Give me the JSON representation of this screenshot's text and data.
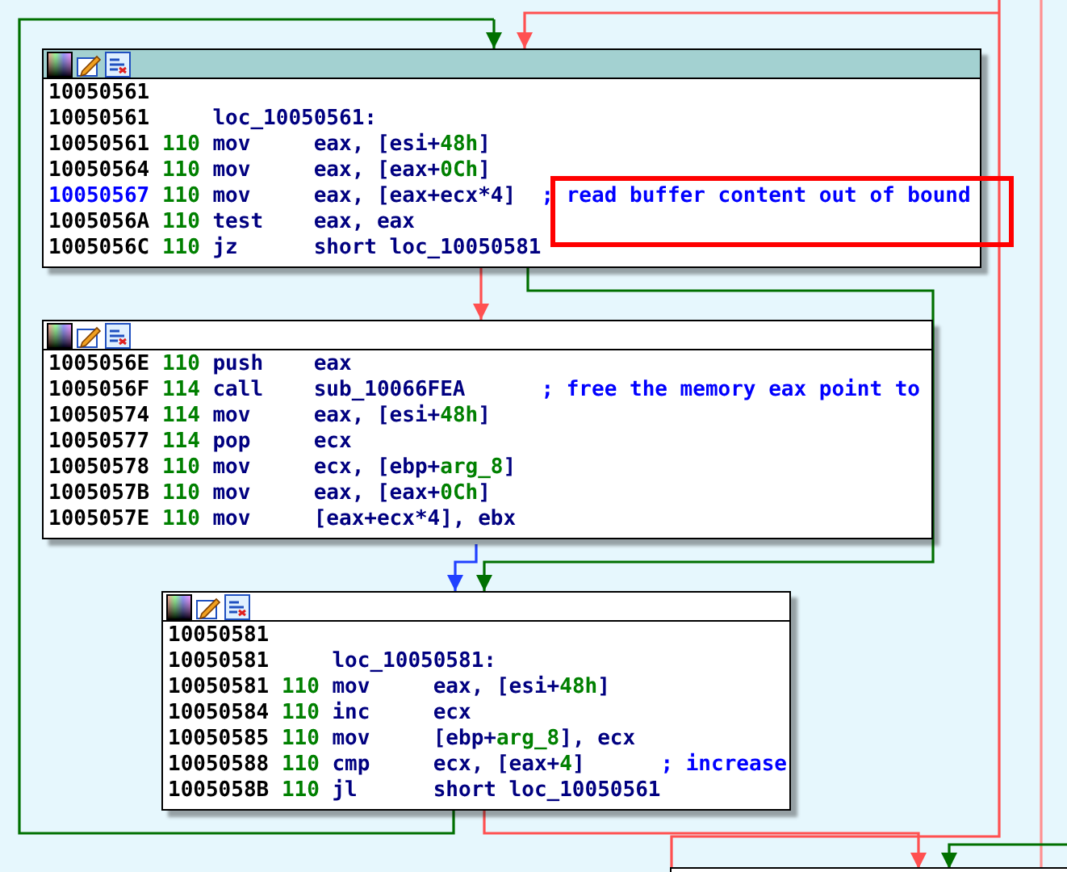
{
  "blocks": [
    {
      "selected": true,
      "lines": [
        {
          "current": false,
          "address": "10050561"
        },
        {
          "current": false,
          "address": "10050561",
          "label": "loc_10050561:"
        },
        {
          "current": false,
          "address": "10050561",
          "stack": "110",
          "mnemonic": "mov",
          "operands": [
            {
              "kind": "reg",
              "text": "eax, [esi+"
            },
            {
              "kind": "num",
              "text": "48h"
            },
            {
              "kind": "reg",
              "text": "]"
            }
          ]
        },
        {
          "current": false,
          "address": "10050564",
          "stack": "110",
          "mnemonic": "mov",
          "operands": [
            {
              "kind": "reg",
              "text": "eax, [eax+"
            },
            {
              "kind": "num",
              "text": "0Ch"
            },
            {
              "kind": "reg",
              "text": "]"
            }
          ]
        },
        {
          "current": true,
          "address": "10050567",
          "stack": "110",
          "mnemonic": "mov",
          "operands": [
            {
              "kind": "reg",
              "text": "eax, [eax+ecx*4]"
            }
          ],
          "comment": "; read buffer content out of bound"
        },
        {
          "current": false,
          "address": "1005056A",
          "stack": "110",
          "mnemonic": "test",
          "operands": [
            {
              "kind": "reg",
              "text": "eax, eax"
            }
          ]
        },
        {
          "current": false,
          "address": "1005056C",
          "stack": "110",
          "mnemonic": "jz",
          "operands": [
            {
              "kind": "reg",
              "text": "short loc_10050581"
            }
          ]
        }
      ]
    },
    {
      "selected": false,
      "lines": [
        {
          "current": false,
          "address": "1005056E",
          "stack": "110",
          "mnemonic": "push",
          "operands": [
            {
              "kind": "reg",
              "text": "eax"
            }
          ]
        },
        {
          "current": false,
          "address": "1005056F",
          "stack": "114",
          "mnemonic": "call",
          "operands": [
            {
              "kind": "reg",
              "text": "sub_10066FEA"
            }
          ],
          "comment": "; free the memory eax point to"
        },
        {
          "current": false,
          "address": "10050574",
          "stack": "114",
          "mnemonic": "mov",
          "operands": [
            {
              "kind": "reg",
              "text": "eax, [esi+"
            },
            {
              "kind": "num",
              "text": "48h"
            },
            {
              "kind": "reg",
              "text": "]"
            }
          ]
        },
        {
          "current": false,
          "address": "10050577",
          "stack": "114",
          "mnemonic": "pop",
          "operands": [
            {
              "kind": "reg",
              "text": "ecx"
            }
          ]
        },
        {
          "current": false,
          "address": "10050578",
          "stack": "110",
          "mnemonic": "mov",
          "operands": [
            {
              "kind": "reg",
              "text": "ecx, [ebp+"
            },
            {
              "kind": "num",
              "text": "arg_8"
            },
            {
              "kind": "reg",
              "text": "]"
            }
          ]
        },
        {
          "current": false,
          "address": "1005057B",
          "stack": "110",
          "mnemonic": "mov",
          "operands": [
            {
              "kind": "reg",
              "text": "eax, [eax+"
            },
            {
              "kind": "num",
              "text": "0Ch"
            },
            {
              "kind": "reg",
              "text": "]"
            }
          ]
        },
        {
          "current": false,
          "address": "1005057E",
          "stack": "110",
          "mnemonic": "mov",
          "operands": [
            {
              "kind": "reg",
              "text": "[eax+ecx*4], ebx"
            }
          ]
        }
      ]
    },
    {
      "selected": false,
      "lines": [
        {
          "current": false,
          "address": "10050581"
        },
        {
          "current": false,
          "address": "10050581",
          "label": "loc_10050581:"
        },
        {
          "current": false,
          "address": "10050581",
          "stack": "110",
          "mnemonic": "mov",
          "operands": [
            {
              "kind": "reg",
              "text": "eax, [esi+"
            },
            {
              "kind": "num",
              "text": "48h"
            },
            {
              "kind": "reg",
              "text": "]"
            }
          ]
        },
        {
          "current": false,
          "address": "10050584",
          "stack": "110",
          "mnemonic": "inc",
          "operands": [
            {
              "kind": "reg",
              "text": "ecx"
            }
          ]
        },
        {
          "current": false,
          "address": "10050585",
          "stack": "110",
          "mnemonic": "mov",
          "operands": [
            {
              "kind": "reg",
              "text": "[ebp+"
            },
            {
              "kind": "num",
              "text": "arg_8"
            },
            {
              "kind": "reg",
              "text": "], ecx"
            }
          ]
        },
        {
          "current": false,
          "address": "10050588",
          "stack": "110",
          "mnemonic": "cmp",
          "operands": [
            {
              "kind": "reg",
              "text": "ecx, [eax+"
            },
            {
              "kind": "num",
              "text": "4"
            },
            {
              "kind": "reg",
              "text": "]"
            }
          ],
          "comment": "; increase"
        },
        {
          "current": false,
          "address": "1005058B",
          "stack": "110",
          "mnemonic": "jl",
          "operands": [
            {
              "kind": "reg",
              "text": "short loc_10050561"
            }
          ]
        }
      ]
    }
  ]
}
